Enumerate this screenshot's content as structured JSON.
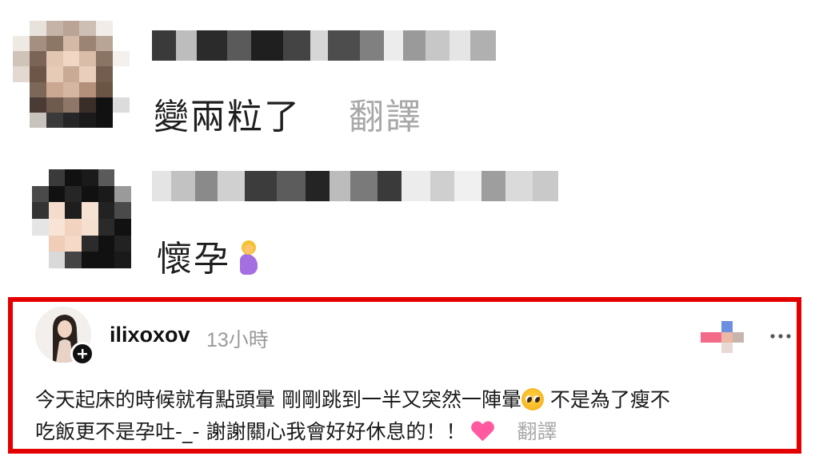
{
  "comments": [
    {
      "username": "",
      "text": "變兩粒了",
      "translate_label": "翻譯",
      "emoji": ""
    },
    {
      "username": "",
      "text": "懷孕",
      "translate_label": "",
      "emoji": "pregnant-woman-emoji"
    }
  ],
  "post": {
    "username": "ilixoxov",
    "time": "13小時",
    "follow_icon": "plus-icon",
    "more_icon": "more-options-icon",
    "text_line1": "今天起床的時候就有點頭暈 剛剛跳到一半又突然一陣暈",
    "emoji1": "pleading-face-emoji",
    "text_line1_end": "不是為了瘦不",
    "text_line2": "吃飯更不是孕吐-_- 謝謝關心我會好好休息的！！",
    "emoji2": "pink-heart-emoji",
    "translate_label": "翻譯"
  },
  "colors": {
    "highlight_border": "#e30000",
    "muted_text": "#a8a8a8"
  }
}
